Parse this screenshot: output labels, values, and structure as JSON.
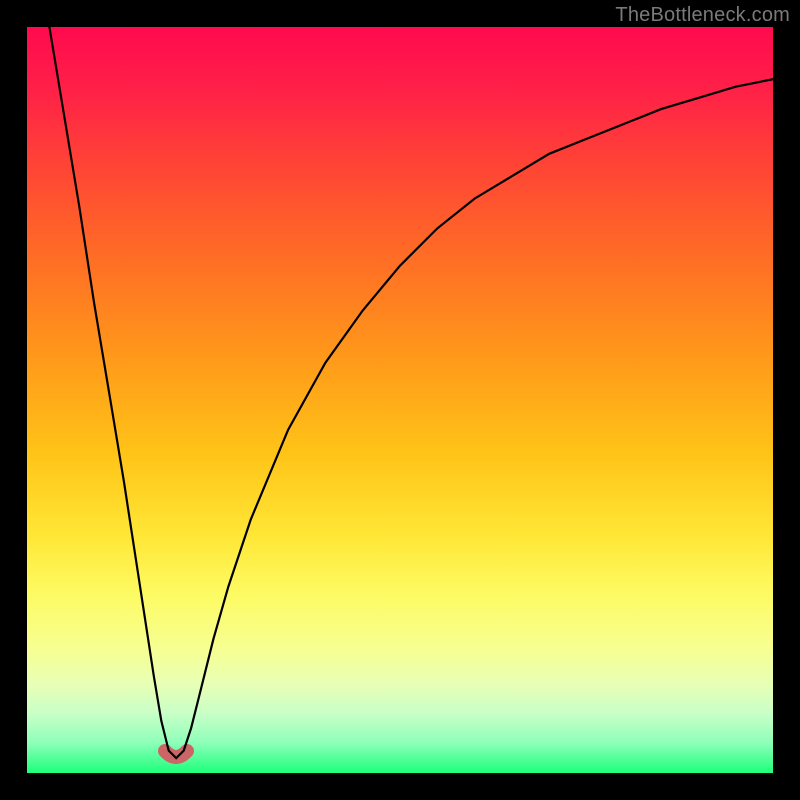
{
  "watermark": "TheBottleneck.com",
  "colors": {
    "frame": "#000000",
    "curve": "#000000",
    "marker": "#cc6666",
    "gradient_top": "#ff0a4e",
    "gradient_bottom": "#1cff7a"
  },
  "chart_data": {
    "type": "line",
    "title": "",
    "xlabel": "",
    "ylabel": "",
    "xlim": [
      0,
      100
    ],
    "ylim": [
      0,
      100
    ],
    "grid": false,
    "legend": false,
    "note": "Single V-shaped curve on a vertical red→green gradient. Axes have no visible tick labels; x and y are normalized 0–100. y≈0 (bottom / green) is good, y≈100 (top / red) is bad. Curve values are read off the plot to ~1% precision.",
    "series": [
      {
        "name": "curve",
        "x": [
          3,
          5,
          7,
          9,
          11,
          13,
          15,
          17,
          18,
          19,
          20,
          21,
          22,
          23,
          25,
          27,
          30,
          35,
          40,
          45,
          50,
          55,
          60,
          65,
          70,
          75,
          80,
          85,
          90,
          95,
          100
        ],
        "y": [
          100,
          88,
          76,
          63,
          51,
          39,
          26,
          13,
          7,
          3,
          2,
          3,
          6,
          10,
          18,
          25,
          34,
          46,
          55,
          62,
          68,
          73,
          77,
          80,
          83,
          85,
          87,
          89,
          90.5,
          92,
          93
        ]
      }
    ],
    "markers": [
      {
        "name": "min-region",
        "x_range": [
          18.5,
          21.5
        ],
        "y": 3
      }
    ],
    "minimum": {
      "x": 20,
      "y": 2
    }
  }
}
